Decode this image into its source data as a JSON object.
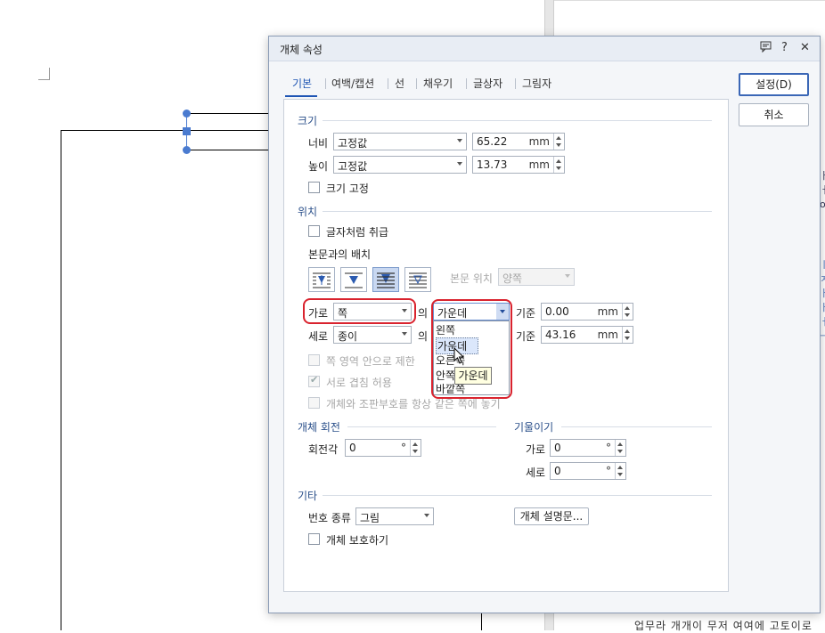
{
  "dialog": {
    "title": "개체 속성",
    "tabs": [
      "기본",
      "여백/캡션",
      "선",
      "채우기",
      "글상자",
      "그림자"
    ],
    "buttons": {
      "ok": "설정(D)",
      "cancel": "취소"
    },
    "titlebar_icons": [
      "comment-icon",
      "help-icon",
      "close-icon"
    ]
  },
  "size": {
    "heading": "크기",
    "width_label": "너비",
    "width_mode": "고정값",
    "width_value": "65.22",
    "width_unit": "mm",
    "height_label": "높이",
    "height_mode": "고정값",
    "height_value": "13.73",
    "height_unit": "mm",
    "lock_label": "크기 고정"
  },
  "position": {
    "heading": "위치",
    "treat_as_char": "글자처럼 취급",
    "wrap_label": "본문과의 배치",
    "body_position_label": "본문 위치",
    "body_position_value": "양쪽",
    "horiz_label": "가로",
    "horiz_ref": "쪽",
    "of1": "의",
    "horiz_align": "가운데",
    "base1": "기준",
    "horiz_offset": "0.00",
    "unit1": "mm",
    "vert_label": "세로",
    "vert_ref": "종이",
    "of2": "의",
    "base2": "기준",
    "vert_offset": "43.16",
    "unit2": "mm",
    "limit_page": "쪽 영역 안으로 제한",
    "allow_overlap": "서로 겹침 허용",
    "same_page": "개체와 조판부호를 항상 같은 쪽에 놓기"
  },
  "dropdown": {
    "items": [
      "왼쪽",
      "가운데",
      "오른쪽",
      "안쪽",
      "바깥쪽"
    ],
    "highlighted": "가운데",
    "tooltip": "가운데"
  },
  "rotation": {
    "heading": "개체 회전",
    "angle_label": "회전각",
    "angle_value": "0",
    "angle_unit": "°"
  },
  "skew": {
    "heading": "기울이기",
    "horiz_label": "가로",
    "horiz_value": "0",
    "vert_label": "세로",
    "vert_value": "0",
    "unit": "°"
  },
  "etc": {
    "heading": "기타",
    "number_type_label": "번호 종류",
    "number_type_value": "그림",
    "description_button": "개체 설명문...",
    "protect_label": "개체 보호하기"
  },
  "background_text": {
    "bottom_line": "업무라 개개이 무저 여여에 고토이로"
  },
  "colors": {
    "accent": "#1e55b4",
    "highlight": "#d9232e",
    "selected": "#c9d8f1"
  }
}
